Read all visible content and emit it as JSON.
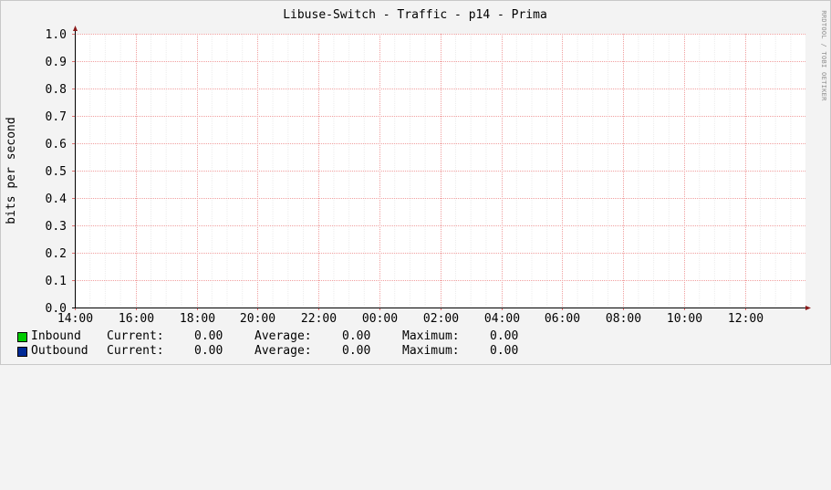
{
  "chart_data": {
    "type": "line",
    "title": "Libuse-Switch - Traffic - p14 - Prima",
    "ylabel": "bits per second",
    "watermark": "RRDTOOL / TOBI OETIKER",
    "ylim": [
      0,
      1.0
    ],
    "yticks": [
      "0.0",
      "0.1",
      "0.2",
      "0.3",
      "0.4",
      "0.5",
      "0.6",
      "0.7",
      "0.8",
      "0.9",
      "1.0"
    ],
    "xticks": [
      "14:00",
      "16:00",
      "18:00",
      "20:00",
      "22:00",
      "00:00",
      "02:00",
      "04:00",
      "06:00",
      "08:00",
      "10:00",
      "12:00"
    ],
    "grid": true,
    "series": [
      {
        "name": "Inbound",
        "color": "#00cc00",
        "values": []
      },
      {
        "name": "Outbound",
        "color": "#002a97",
        "values": []
      }
    ]
  },
  "legend": [
    {
      "name": "Inbound",
      "color": "#00cc00",
      "current_label": "Current:",
      "current": "0.00",
      "average_label": "Average:",
      "average": "0.00",
      "maximum_label": "Maximum:",
      "maximum": "0.00"
    },
    {
      "name": "Outbound",
      "color": "#002a97",
      "current_label": "Current:",
      "current": "0.00",
      "average_label": "Average:",
      "average": "0.00",
      "maximum_label": "Maximum:",
      "maximum": "0.00"
    }
  ]
}
